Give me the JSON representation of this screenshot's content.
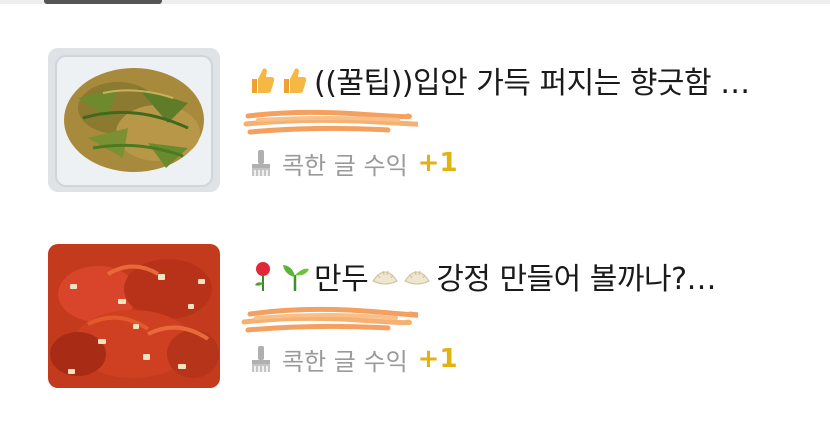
{
  "feed": {
    "items": [
      {
        "title_prefix_icons": [
          "thumbs-up-icon",
          "thumbs-up-icon"
        ],
        "title": "((꿀팁))입안 가득 퍼지는 향긋함 …",
        "meta_label": "콕한 글 수익",
        "meta_value": "+1"
      },
      {
        "title_prefix_icons": [
          "rose-icon",
          "seedling-icon"
        ],
        "title_a": "만두",
        "mid_icons": [
          "dumpling-icon",
          "dumpling-icon"
        ],
        "title_b": "강정 만들어 볼까나?…",
        "meta_label": "콕한 글 수익",
        "meta_value": "+1"
      }
    ]
  },
  "colors": {
    "accent": "#e2b211",
    "meta_text": "#9a9a9a",
    "redaction": "#f4a060"
  }
}
